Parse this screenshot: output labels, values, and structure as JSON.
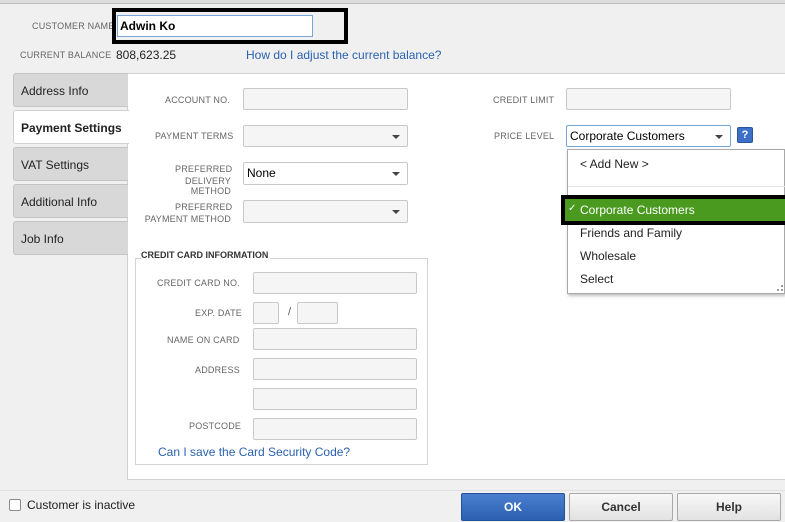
{
  "header": {
    "customer_name_label": "CUSTOMER NAME",
    "customer_name_value": "Adwin Ko",
    "current_balance_label": "CURRENT BALANCE",
    "current_balance_value": "808,623.25",
    "adjust_balance_link": "How do I adjust the current balance?"
  },
  "tabs": [
    {
      "label": "Address Info"
    },
    {
      "label": "Payment Settings"
    },
    {
      "label": "VAT Settings"
    },
    {
      "label": "Additional Info"
    },
    {
      "label": "Job Info"
    }
  ],
  "payment": {
    "account_no_label": "ACCOUNT NO.",
    "credit_limit_label": "CREDIT LIMIT",
    "payment_terms_label": "PAYMENT TERMS",
    "price_level_label": "PRICE LEVEL",
    "price_level_value": "Corporate Customers",
    "help_glyph": "?",
    "delivery_label_1": "PREFERRED",
    "delivery_label_2": "DELIVERY METHOD",
    "delivery_value": "None",
    "paymethod_label_1": "PREFERRED",
    "paymethod_label_2": "PAYMENT METHOD"
  },
  "credit_card": {
    "section_title": "CREDIT CARD INFORMATION",
    "card_no_label": "CREDIT CARD NO.",
    "exp_date_label": "EXP. DATE",
    "exp_sep": "/",
    "name_label": "NAME ON CARD",
    "address_label": "ADDRESS",
    "postcode_label": "POSTCODE",
    "security_link": "Can I save the Card Security Code?"
  },
  "price_dropdown": {
    "add_new": "< Add New >",
    "items": [
      {
        "label": "Corporate Customers",
        "selected": true
      },
      {
        "label": "Friends and Family",
        "selected": false
      },
      {
        "label": "Wholesale",
        "selected": false
      },
      {
        "label": "Select",
        "selected": false
      }
    ],
    "check_glyph": "✓"
  },
  "footer": {
    "inactive_label": "Customer is inactive",
    "ok_label": "OK",
    "cancel_label": "Cancel",
    "help_label": "Help"
  },
  "colors": {
    "selected_item_bg": "#4a9a1f",
    "link": "#2a62b0",
    "ok_button": "#2c5fb0",
    "highlight_frame": "#000000"
  }
}
